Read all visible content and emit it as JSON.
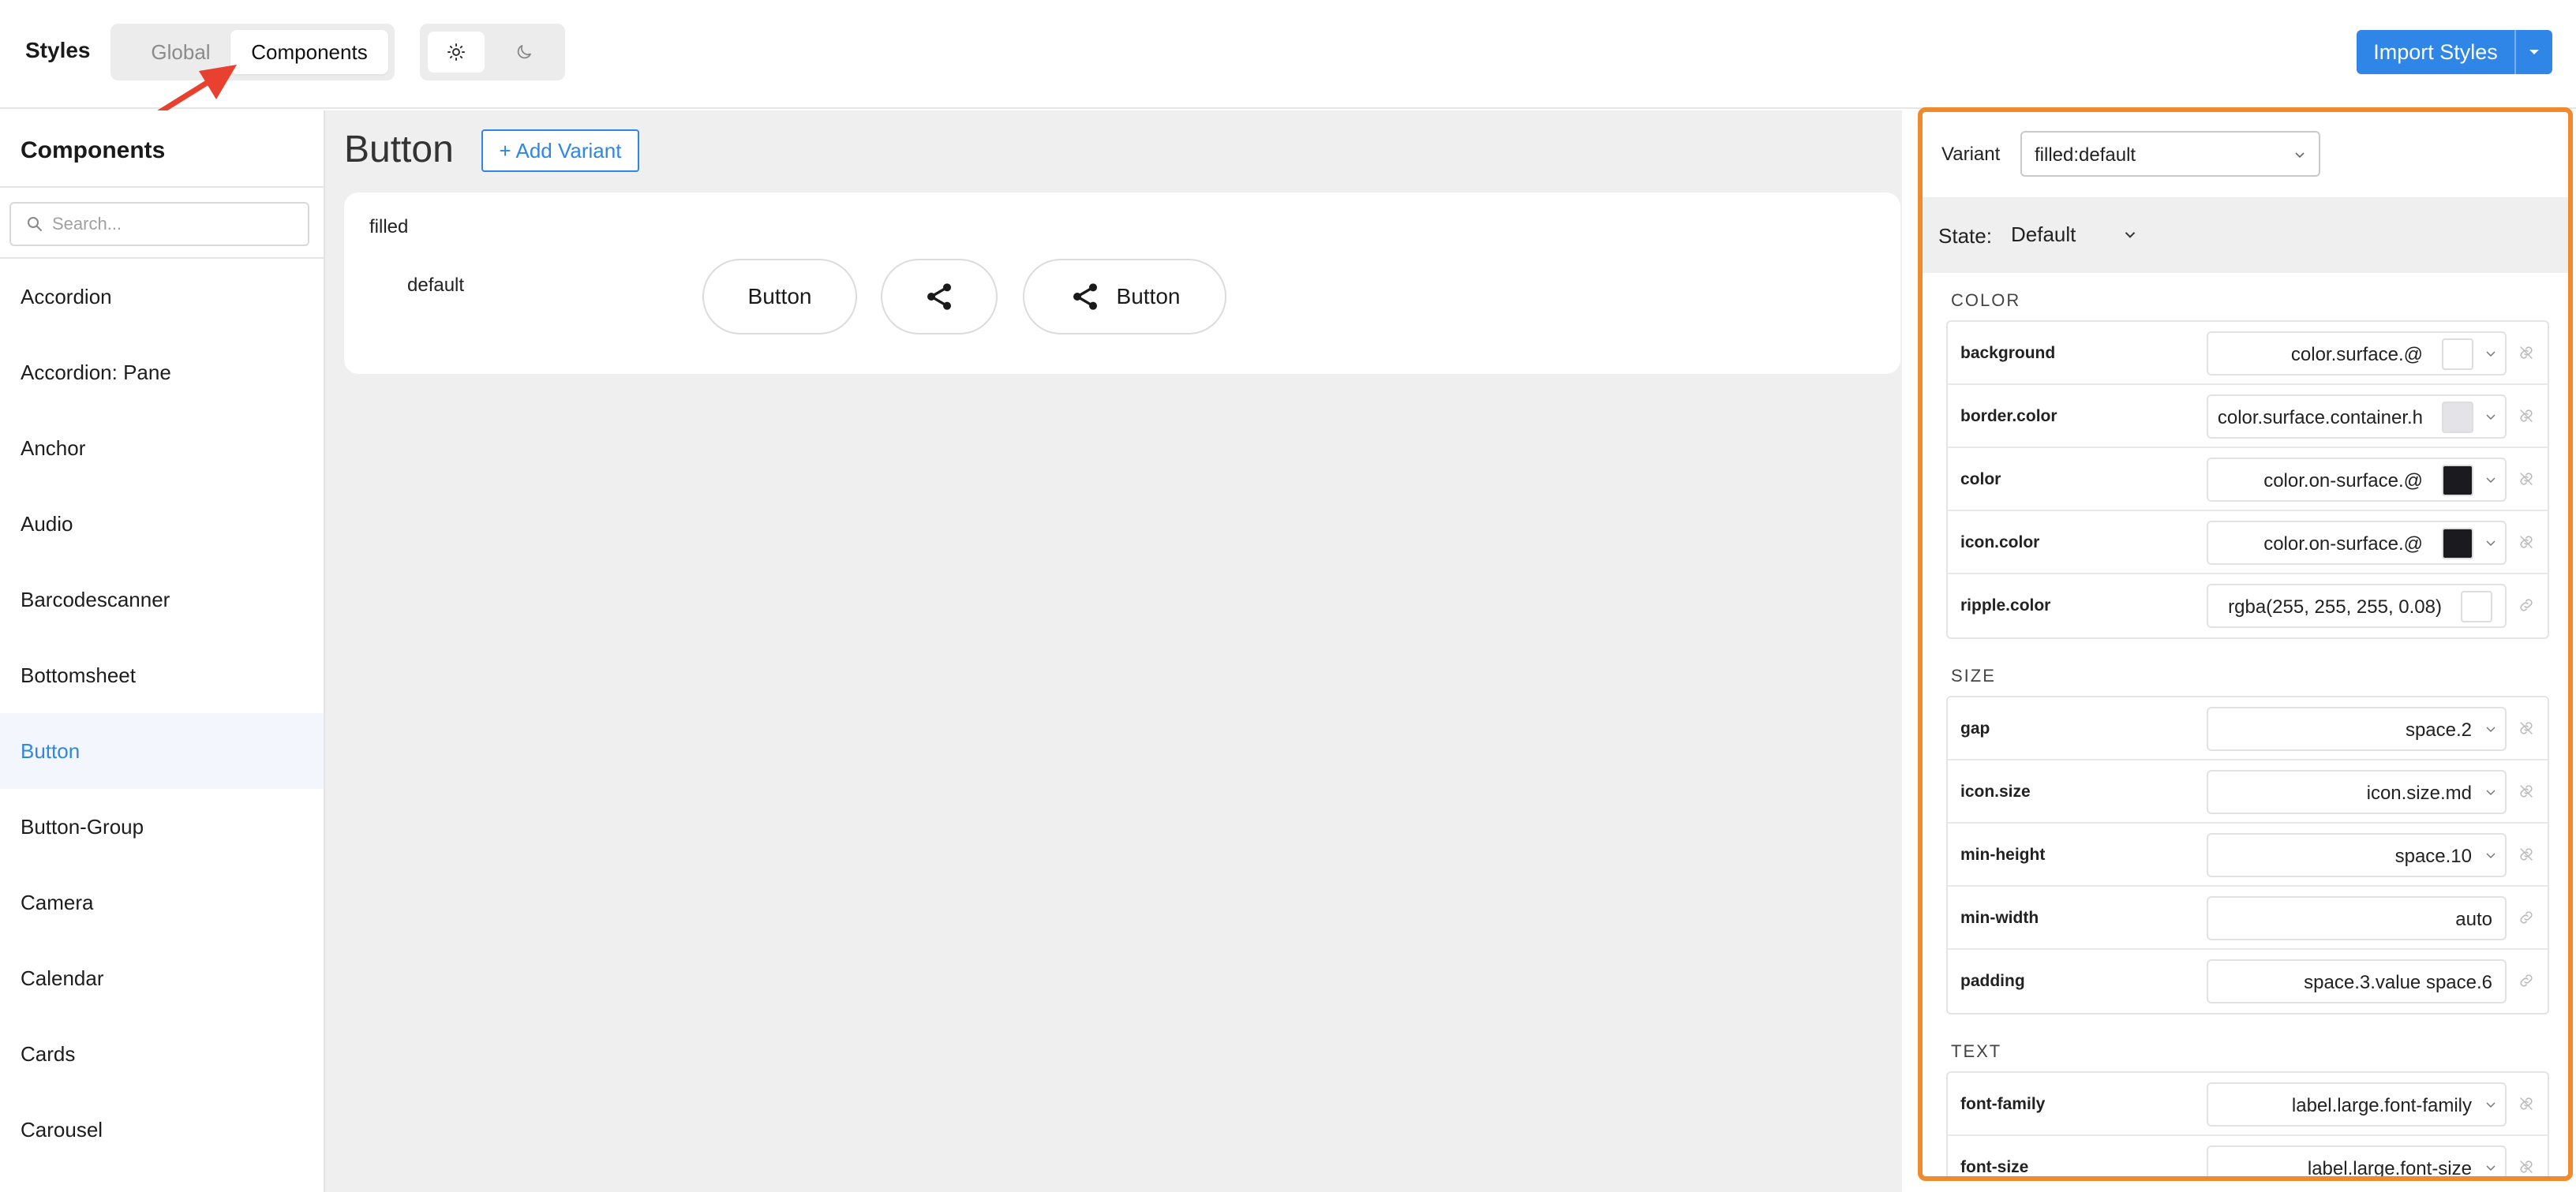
{
  "header": {
    "title": "Styles",
    "tabs": [
      "Global",
      "Components"
    ],
    "active_tab": "Components",
    "theme_modes": [
      "light",
      "dark"
    ],
    "import_label": "Import Styles"
  },
  "sidebar": {
    "title": "Components",
    "search_placeholder": "Search...",
    "items": [
      {
        "label": "Accordion"
      },
      {
        "label": "Accordion: Pane"
      },
      {
        "label": "Anchor"
      },
      {
        "label": "Audio"
      },
      {
        "label": "Barcodescanner"
      },
      {
        "label": "Bottomsheet"
      },
      {
        "label": "Button",
        "active": true
      },
      {
        "label": "Button-Group"
      },
      {
        "label": "Camera"
      },
      {
        "label": "Calendar"
      },
      {
        "label": "Cards"
      },
      {
        "label": "Carousel"
      }
    ]
  },
  "main": {
    "title": "Button",
    "add_variant_label": "+ Add Variant",
    "group_label": "filled",
    "variant_label": "default",
    "preview_buttons": [
      {
        "label": "Button",
        "icon": ""
      },
      {
        "label": "",
        "icon": "share-icon"
      },
      {
        "label": "Button",
        "icon": "share-icon"
      }
    ]
  },
  "panel": {
    "variant_label": "Variant",
    "variant_value": "filled:default",
    "state_label": "State:",
    "state_value": "Default",
    "sections": [
      {
        "title": "COLOR",
        "props": [
          {
            "name": "background",
            "value": "color.surface.@",
            "swatch": "#ffffff",
            "dropdown": true
          },
          {
            "name": "border.color",
            "value": "color.surface.container.h",
            "swatch": "#e3e3e8",
            "dropdown": true
          },
          {
            "name": "color",
            "value": "color.on-surface.@",
            "swatch": "#1b1b1f",
            "dropdown": true
          },
          {
            "name": "icon.color",
            "value": "color.on-surface.@",
            "swatch": "#1b1b1f",
            "dropdown": true
          },
          {
            "name": "ripple.color",
            "value": "rgba(255, 255, 255, 0.08)",
            "swatch": "#ffffff",
            "dropdown": false
          }
        ]
      },
      {
        "title": "SIZE",
        "props": [
          {
            "name": "gap",
            "value": "space.2",
            "dropdown": true
          },
          {
            "name": "icon.size",
            "value": "icon.size.md",
            "dropdown": true
          },
          {
            "name": "min-height",
            "value": "space.10",
            "dropdown": true
          },
          {
            "name": "min-width",
            "value": "auto",
            "dropdown": false
          },
          {
            "name": "padding",
            "value": "space.3.value space.6",
            "dropdown": false
          }
        ]
      },
      {
        "title": "TEXT",
        "props": [
          {
            "name": "font-family",
            "value": "label.large.font-family",
            "dropdown": true
          },
          {
            "name": "font-size",
            "value": "label.large.font-size",
            "dropdown": true
          }
        ]
      }
    ]
  },
  "colors": {
    "accent": "#2f86e6",
    "highlight_border": "#ef8a2e",
    "annotation_arrow": "#e8412f"
  }
}
